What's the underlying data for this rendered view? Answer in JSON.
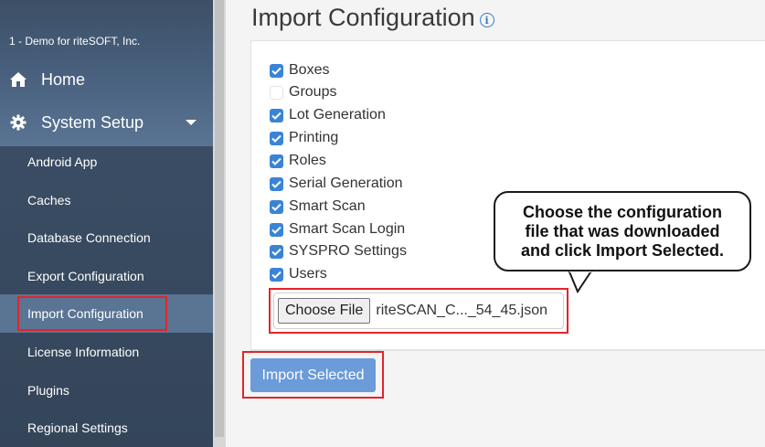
{
  "sidebar": {
    "company": "1 - Demo for riteSOFT, Inc.",
    "home_label": "Home",
    "home_icon": "home-icon",
    "setup_label": "System Setup",
    "setup_icon": "gear-icon",
    "items": [
      {
        "label": "Android App"
      },
      {
        "label": "Caches"
      },
      {
        "label": "Database Connection"
      },
      {
        "label": "Export Configuration"
      },
      {
        "label": "Import Configuration"
      },
      {
        "label": "License Information"
      },
      {
        "label": "Plugins"
      },
      {
        "label": "Regional Settings"
      }
    ]
  },
  "main": {
    "title": "Import Configuration",
    "info_icon": "i",
    "options": [
      {
        "label": "Boxes",
        "checked": true
      },
      {
        "label": "Groups",
        "checked": false
      },
      {
        "label": "Lot Generation",
        "checked": true
      },
      {
        "label": "Printing",
        "checked": true
      },
      {
        "label": "Roles",
        "checked": true
      },
      {
        "label": "Serial Generation",
        "checked": true
      },
      {
        "label": "Smart Scan",
        "checked": true
      },
      {
        "label": "Smart Scan Login",
        "checked": true
      },
      {
        "label": "SYSPRO Settings",
        "checked": true
      },
      {
        "label": "Users",
        "checked": true
      }
    ],
    "choose_file_label": "Choose File",
    "file_name": "riteSCAN_C..._54_45.json",
    "import_button": "Import Selected"
  },
  "callout": {
    "text": "Choose the configuration\nfile that was downloaded\nand click Import Selected."
  },
  "colors": {
    "accent": "#3a84d6",
    "highlight": "#e3242b",
    "sidebar": "#3a4d64",
    "active_item": "#5a7493",
    "import_button": "#6b9bd8"
  }
}
